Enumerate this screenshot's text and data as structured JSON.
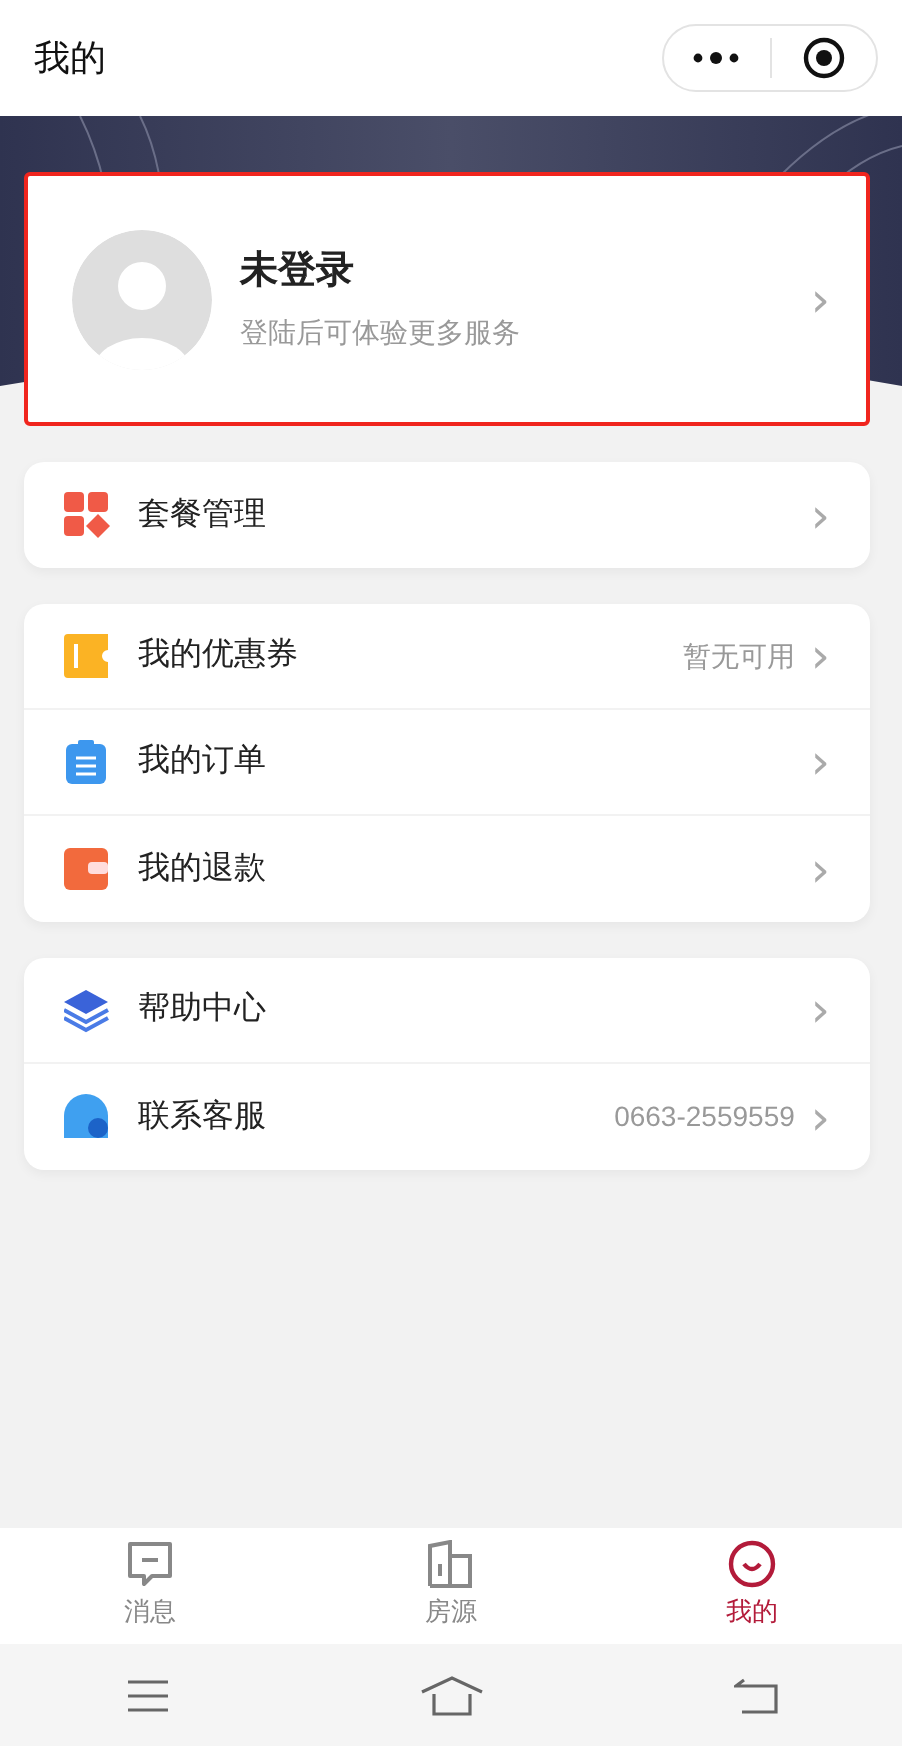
{
  "header": {
    "title": "我的"
  },
  "profile": {
    "name": "未登录",
    "hint": "登陆后可体验更多服务",
    "chevron": "›"
  },
  "menu_groups": [
    {
      "items": [
        {
          "label": "套餐管理",
          "chevron": "›"
        }
      ]
    },
    {
      "items": [
        {
          "label": "我的优惠券",
          "value": "暂无可用",
          "chevron": "›"
        },
        {
          "label": "我的订单",
          "chevron": "›"
        },
        {
          "label": "我的退款",
          "chevron": "›"
        }
      ]
    },
    {
      "items": [
        {
          "label": "帮助中心",
          "chevron": "›"
        },
        {
          "label": "联系客服",
          "value": "0663-2559559",
          "chevron": "›"
        }
      ]
    }
  ],
  "tab_bar": [
    {
      "label": "消息",
      "selected": false
    },
    {
      "label": "房源",
      "selected": false
    },
    {
      "label": "我的",
      "selected": true
    }
  ]
}
